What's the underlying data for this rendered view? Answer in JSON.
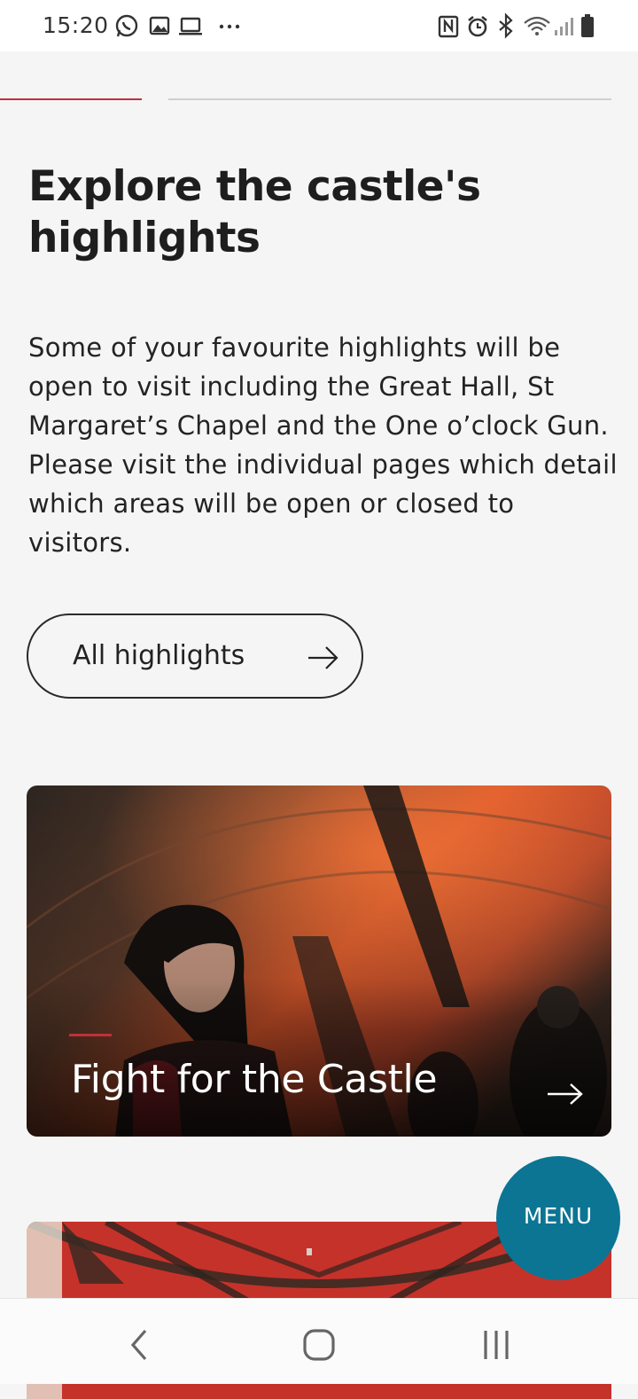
{
  "status_bar": {
    "time": "15:20",
    "left_icons": [
      "whatsapp-icon",
      "gallery-icon",
      "laptop-icon",
      "more-dots-icon"
    ],
    "right_icons": [
      "nfc-icon",
      "alarm-icon",
      "bluetooth-icon",
      "wifi-icon",
      "signal-icon",
      "battery-icon"
    ]
  },
  "section": {
    "title": "Explore the castle's highlights",
    "body": "Some of your favourite highlights will be open to visit including the Great Hall, St Margaret’s Chapel and the One o’clock Gun. Please visit the individual pages which detail which areas will be open or closed to visitors.",
    "button_label": "All highlights"
  },
  "cards": [
    {
      "title": "Fight for the Castle"
    }
  ],
  "menu_fab": {
    "label": "MENU"
  },
  "nav_bar": {
    "buttons": [
      "back-icon",
      "home-icon",
      "recent-apps-icon"
    ]
  },
  "colors": {
    "accent_red": "#c0303a",
    "menu_teal": "#0b7593",
    "background": "#f5f5f5",
    "text": "#1e1e1e"
  }
}
